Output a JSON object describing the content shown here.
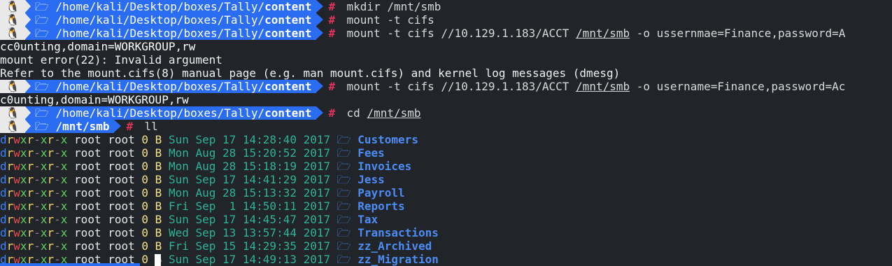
{
  "prompt": {
    "icon": "🐧",
    "folder_glyph": "🗁",
    "hash": "#"
  },
  "history": [
    {
      "kind": "prompt",
      "path_prefix": " /home/kali/Desktop/boxes/Tally/",
      "path_dir": "content",
      "cmd_parts": [
        {
          "t": "mkdir /mnt/smb",
          "u": false
        }
      ]
    },
    {
      "kind": "prompt",
      "path_prefix": " /home/kali/Desktop/boxes/Tally/",
      "path_dir": "content",
      "cmd_parts": [
        {
          "t": "mount -t cifs",
          "u": false
        }
      ]
    },
    {
      "kind": "prompt",
      "path_prefix": " /home/kali/Desktop/boxes/Tally/",
      "path_dir": "content",
      "cmd_parts": [
        {
          "t": "mount -t cifs //10.129.1.183/ACCT ",
          "u": false
        },
        {
          "t": "/mnt/smb",
          "u": true
        },
        {
          "t": " -o ussernmae=Finance,password=A",
          "u": false
        }
      ]
    },
    {
      "kind": "text",
      "text": "cc0unting,domain=WORKGROUP,rw"
    },
    {
      "kind": "text",
      "text": "mount error(22): Invalid argument"
    },
    {
      "kind": "text",
      "text": "Refer to the mount.cifs(8) manual page (e.g. man mount.cifs) and kernel log messages (dmesg)"
    },
    {
      "kind": "prompt",
      "path_prefix": " /home/kali/Desktop/boxes/Tally/",
      "path_dir": "content",
      "cmd_parts": [
        {
          "t": "mount -t cifs //10.129.1.183/ACCT ",
          "u": false
        },
        {
          "t": "/mnt/smb",
          "u": true
        },
        {
          "t": " -o username=Finance,password=Ac",
          "u": false
        }
      ]
    },
    {
      "kind": "text",
      "text": "c0unting,domain=WORKGROUP,rw"
    },
    {
      "kind": "prompt",
      "path_prefix": " /home/kali/Desktop/boxes/Tally/",
      "path_dir": "content",
      "cmd_parts": [
        {
          "t": "cd ",
          "u": false
        },
        {
          "t": "/mnt/smb",
          "u": true
        }
      ]
    },
    {
      "kind": "prompt",
      "path_prefix": " ",
      "path_dir": "/mnt/smb",
      "cmd_parts": [
        {
          "t": "ll",
          "u": false
        }
      ]
    }
  ],
  "listing": {
    "permissions": "drwxr-xr-x",
    "owner": "root",
    "group": "root",
    "size": "0 B",
    "rows": [
      {
        "date": "Sun Sep 17 14:28:40 2017",
        "name": "Customers"
      },
      {
        "date": "Mon Aug 28 15:20:52 2017",
        "name": "Fees"
      },
      {
        "date": "Mon Aug 28 15:18:19 2017",
        "name": "Invoices"
      },
      {
        "date": "Sun Sep 17 14:41:29 2017",
        "name": "Jess"
      },
      {
        "date": "Mon Aug 28 15:13:32 2017",
        "name": "Payroll"
      },
      {
        "date": "Fri Sep  1 14:50:11 2017",
        "name": "Reports"
      },
      {
        "date": "Sun Sep 17 14:45:47 2017",
        "name": "Tax"
      },
      {
        "date": "Wed Sep 13 13:57:44 2017",
        "name": "Transactions"
      },
      {
        "date": "Fri Sep 15 14:29:35 2017",
        "name": "zz_Archived"
      },
      {
        "date": "Sun Sep 17 14:49:13 2017",
        "name": "zz_Migration"
      }
    ]
  },
  "colors": {
    "background": "#212429",
    "prompt_path_bg": "#2a6df2",
    "prompt_hash": "#e0335a",
    "folder_name": "#4c8cf5",
    "date": "#2eb398"
  }
}
